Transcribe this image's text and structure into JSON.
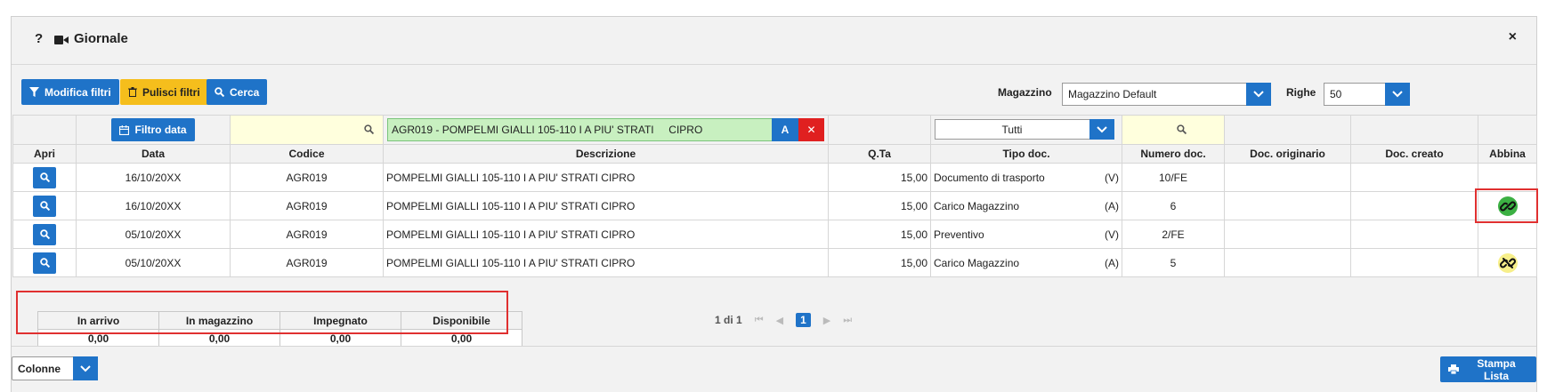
{
  "header": {
    "help": "?",
    "title": "Giornale",
    "close": "×"
  },
  "toolbar": {
    "modify_filters": "Modifica filtri",
    "clear_filters": "Pulisci filtri",
    "search": "Cerca",
    "warehouse_label": "Magazzino",
    "warehouse_value": "Magazzino Default",
    "rows_label": "Righe",
    "rows_value": "50"
  },
  "filters": {
    "date_button": "Filtro data",
    "description": "AGR019 - POMPELMI GIALLI 105-110 I A PIU' STRATI     CIPRO",
    "desc_a": "A",
    "desc_x": "✕",
    "doc_type": "Tutti"
  },
  "columns": [
    "Apri",
    "Data",
    "Codice",
    "Descrizione",
    "Q.Ta",
    "Tipo doc.",
    "Numero doc.",
    "Doc. originario",
    "Doc. creato",
    "Abbina"
  ],
  "rows": [
    {
      "date": "16/10/20XX",
      "code": "AGR019",
      "desc": "POMPELMI GIALLI 105-110 I A PIU' STRATI CIPRO",
      "qty": "15,00",
      "type": "Documento di trasporto",
      "dir": "(V)",
      "num": "10/FE",
      "link": ""
    },
    {
      "date": "16/10/20XX",
      "code": "AGR019",
      "desc": "POMPELMI GIALLI 105-110 I A PIU' STRATI CIPRO",
      "qty": "15,00",
      "type": "Carico Magazzino",
      "dir": "(A)",
      "num": "6",
      "link": "linked"
    },
    {
      "date": "05/10/20XX",
      "code": "AGR019",
      "desc": "POMPELMI GIALLI 105-110 I A PIU' STRATI CIPRO",
      "qty": "15,00",
      "type": "Preventivo",
      "dir": "(V)",
      "num": "2/FE",
      "link": ""
    },
    {
      "date": "05/10/20XX",
      "code": "AGR019",
      "desc": "POMPELMI GIALLI 105-110 I A PIU' STRATI CIPRO",
      "qty": "15,00",
      "type": "Carico Magazzino",
      "dir": "(A)",
      "num": "5",
      "link": "unlinked"
    }
  ],
  "summary": {
    "headers": [
      "In arrivo",
      "In magazzino",
      "Impegnato",
      "Disponibile"
    ],
    "values": [
      "0,00",
      "0,00",
      "0,00",
      "0,00"
    ]
  },
  "pager": {
    "info": "1 di 1",
    "current": "1"
  },
  "footer": {
    "columns_select": "Colonne",
    "print": "Stampa Lista"
  },
  "colors": {
    "primary": "#1f73c8",
    "warning": "#f5be1c",
    "danger": "#e02020",
    "link_green": "#3cb043",
    "unlink_yellow": "#f7ef8a"
  }
}
